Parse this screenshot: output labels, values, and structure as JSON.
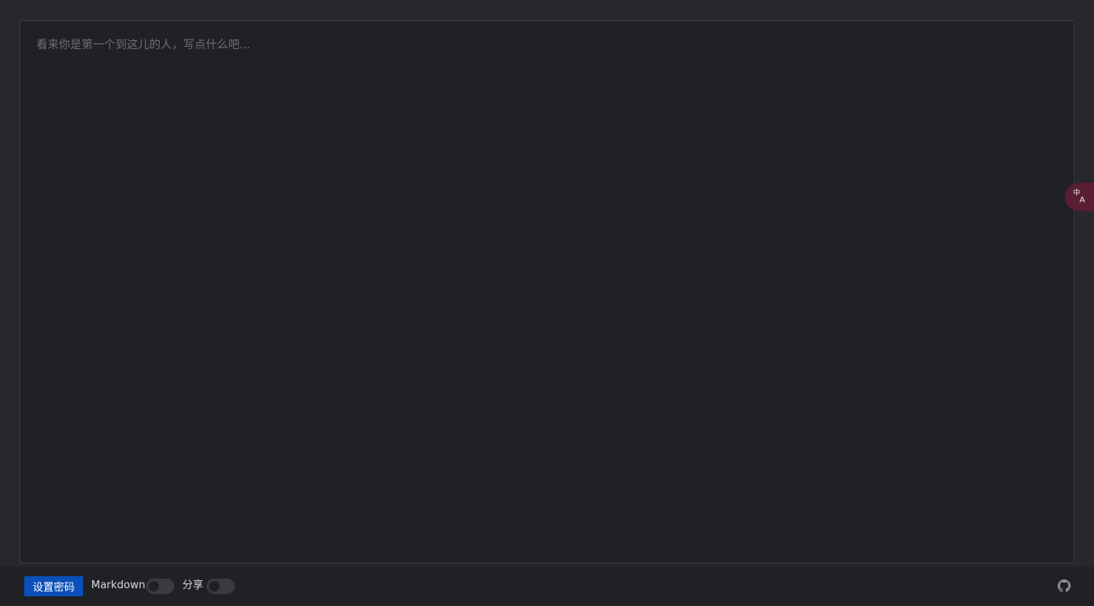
{
  "editor": {
    "placeholder": "看来你是第一个到这儿的人，写点什么吧...",
    "value": ""
  },
  "translate_button": {
    "icon": "translate-icon"
  },
  "footer": {
    "password_button_label": "设置密码",
    "markdown_label": "Markdown",
    "markdown_enabled": false,
    "share_label": "分享",
    "share_enabled": false,
    "github_icon": "github-icon"
  },
  "colors": {
    "background": "#27282c",
    "editor_background": "#202124",
    "primary_button": "#0b4fb8",
    "translate_fab": "#5a1e34"
  }
}
